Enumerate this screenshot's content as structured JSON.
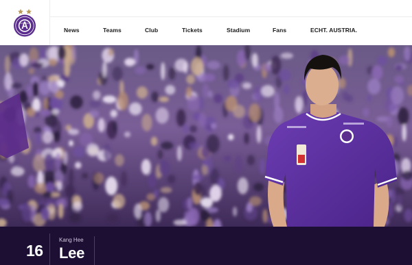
{
  "header": {
    "nav": [
      {
        "label": "News",
        "name": "nav-news"
      },
      {
        "label": "Teams",
        "name": "nav-teams"
      },
      {
        "label": "Club",
        "name": "nav-club"
      },
      {
        "label": "Tickets",
        "name": "nav-tickets"
      },
      {
        "label": "Stadium",
        "name": "nav-stadium"
      },
      {
        "label": "Fans",
        "name": "nav-fans"
      },
      {
        "label": "ECHT. AUSTRIA.",
        "name": "nav-echt-austria"
      }
    ]
  },
  "player": {
    "number": "16",
    "first_name": "Kang Hee",
    "last_name": "Lee"
  },
  "colors": {
    "brand_purple": "#5a2d8e",
    "bar_background": "#1d0f33",
    "gold": "#b89a5a"
  },
  "icons": {
    "logo": "fk-austria-wien-crest"
  }
}
